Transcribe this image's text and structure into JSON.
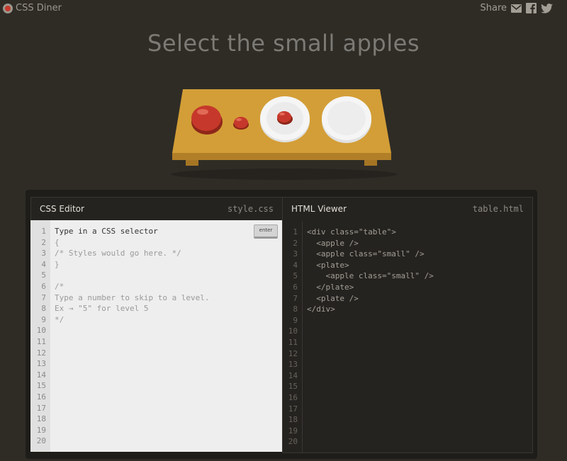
{
  "brand": {
    "name": "CSS Diner",
    "logo_icon": "tomato-logo-icon"
  },
  "share": {
    "label": "Share",
    "icons": [
      "mail-icon",
      "facebook-icon",
      "twitter-icon"
    ]
  },
  "level": {
    "instruction": "Select the small apples"
  },
  "css_editor": {
    "title": "CSS Editor",
    "file": "style.css",
    "enter_label": "enter",
    "line_numbers": [
      "1",
      "2",
      "3",
      "4",
      "5",
      "6",
      "7",
      "8",
      "9",
      "10",
      "11",
      "12",
      "13",
      "14",
      "15",
      "16",
      "17",
      "18",
      "19",
      "20"
    ],
    "lines": [
      "Type in a CSS selector",
      "{",
      "/* Styles would go here. */",
      "}",
      "",
      "/*",
      "Type a number to skip to a level.",
      "Ex → \"5\" for level 5",
      "*/"
    ]
  },
  "html_viewer": {
    "title": "HTML Viewer",
    "file": "table.html",
    "line_numbers": [
      "1",
      "2",
      "3",
      "4",
      "5",
      "6",
      "7",
      "8",
      "9",
      "10",
      "11",
      "12",
      "13",
      "14",
      "15",
      "16",
      "17",
      "18",
      "19",
      "20"
    ],
    "lines": [
      "<div class=\"table\">",
      "  <apple />",
      "  <apple class=\"small\" />",
      "  <plate>",
      "    <apple class=\"small\" />",
      "  </plate>",
      "  <plate />",
      "</div>"
    ]
  },
  "colors": {
    "background": "#2f2c26",
    "table": "#d39e37",
    "apple": "#c6382b",
    "plate": "#f2f2f2"
  }
}
